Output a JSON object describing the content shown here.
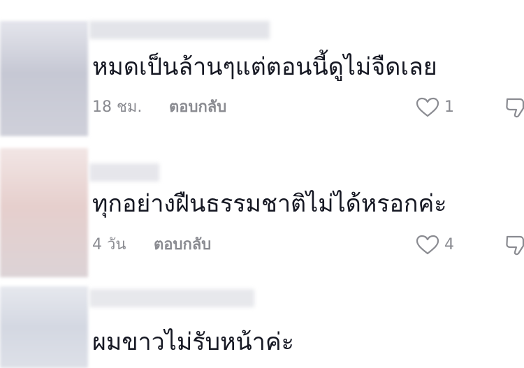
{
  "comments": [
    {
      "text": "หมดเป็นล้านๆแต่ตอนนี้ดูไม่จืดเลย",
      "time": "18 ชม.",
      "reply_label": "ตอบกลับ",
      "like_count": "1",
      "avatar_color": "#c9cad6",
      "username_color": "#e2e3e8"
    },
    {
      "text": "ทุกอย่างฝืนธรรมชาติไม่ได้หรอกค่ะ",
      "time": "4 วัน",
      "reply_label": "ตอบกลับ",
      "like_count": "4",
      "avatar_color": "#e9d6d4",
      "username_color": "#e5e5ea"
    },
    {
      "text": "ผมขาวไม่รับหน้าค่ะ",
      "avatar_color": "#d8dce6",
      "username_color": "#e6e7ec"
    }
  ],
  "icons": {
    "like": "heart-outline-icon",
    "dislike": "thumbs-down-icon"
  },
  "colors": {
    "text": "#161823",
    "meta": "#8a8b91",
    "icon": "#8a8b91"
  }
}
